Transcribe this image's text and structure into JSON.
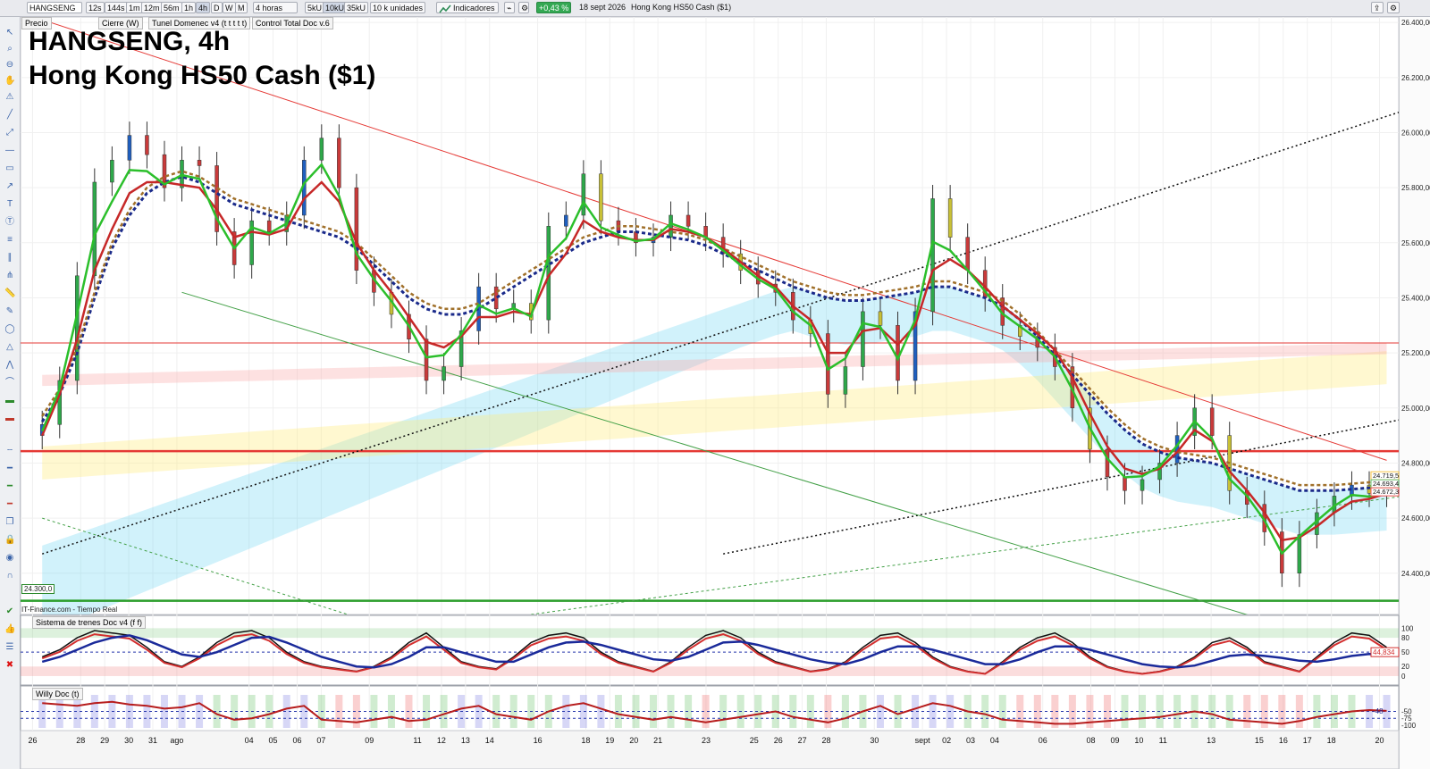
{
  "toolbar": {
    "symbol": "HANGSENG",
    "timeframes": [
      "12s",
      "144s",
      "1m",
      "12m",
      "56m",
      "1h",
      "4h",
      "D",
      "W",
      "M"
    ],
    "period": "4 horas",
    "units": [
      "5kU",
      "10kU",
      "35kU"
    ],
    "quantity": "10 k unidades",
    "indicators_label": "Indicadores",
    "change": "+0,43 %",
    "date": "18 sept 2026",
    "instrument": "Hong Kong HS50 Cash ($1)"
  },
  "legend_items": [
    "Precio",
    "Cierre (W)",
    "Tunel Domenec v4 (t t t t t)",
    "Control Total Doc v.6"
  ],
  "chart_data": [
    {
      "type": "line",
      "title": "HANGSENG, 4h",
      "subtitle": "Hong Kong HS50 Cash ($1)",
      "ylim": [
        24250,
        26420
      ],
      "y_ticks": [
        26400,
        26200,
        26000,
        25800,
        25600,
        25400,
        25200,
        25000,
        24800,
        24600,
        24400
      ],
      "x_labels": [
        "26",
        "28",
        "29",
        "30",
        "31",
        "ago",
        "04",
        "05",
        "06",
        "07",
        "09",
        "11",
        "12",
        "13",
        "14",
        "16",
        "18",
        "19",
        "20",
        "21",
        "23",
        "25",
        "26",
        "27",
        "28",
        "30",
        "sept",
        "02",
        "03",
        "04",
        "06",
        "08",
        "09",
        "10",
        "11",
        "13",
        "15",
        "16",
        "17",
        "18",
        "20"
      ],
      "x": [
        0,
        2,
        3,
        4,
        5,
        6,
        9,
        10,
        11,
        12,
        14,
        16,
        17,
        18,
        19,
        21,
        23,
        24,
        25,
        26,
        28,
        30,
        31,
        32,
        33,
        35,
        37,
        38,
        39,
        40,
        42,
        44,
        45,
        46,
        47,
        49,
        51,
        52,
        53,
        54,
        56
      ],
      "x_range": [
        -0.5,
        56.8
      ],
      "close": [
        24940,
        25100,
        25480,
        25820,
        25900,
        25990,
        25920,
        25800,
        25900,
        25880,
        25640,
        25520,
        25680,
        25640,
        25700,
        25900,
        25980,
        25800,
        25500,
        25420,
        25340,
        25250,
        25100,
        25150,
        25280,
        25440,
        25360,
        25380,
        25320,
        25660,
        25700,
        25850,
        25680,
        25640,
        25600,
        25620,
        25700,
        25660,
        25620,
        25560,
        25500,
        25450,
        25420,
        25320,
        25270,
        25050,
        25150,
        25350,
        25300,
        25100,
        25350,
        25760,
        25620,
        25500,
        25400,
        25300,
        25260,
        25220,
        25150,
        25000,
        24850,
        24750,
        24700,
        24740,
        24800,
        24900,
        25000,
        24900,
        24700,
        24650,
        24550,
        24400,
        24540,
        24620,
        24680,
        24720,
        24690,
        24710
      ],
      "moving_average": [
        24900,
        25050,
        25250,
        25500,
        25650,
        25780,
        25820,
        25820,
        25810,
        25800,
        25720,
        25620,
        25640,
        25630,
        25650,
        25760,
        25820,
        25750,
        25600,
        25500,
        25420,
        25330,
        25240,
        25220,
        25260,
        25330,
        25330,
        25350,
        25340,
        25480,
        25560,
        25680,
        25640,
        25620,
        25610,
        25610,
        25650,
        25640,
        25620,
        25580,
        25530,
        25480,
        25440,
        25370,
        25320,
        25200,
        25200,
        25280,
        25290,
        25230,
        25300,
        25500,
        25540,
        25500,
        25440,
        25370,
        25320,
        25270,
        25210,
        25110,
        24980,
        24860,
        24780,
        24760,
        24780,
        24840,
        24920,
        24880,
        24770,
        24700,
        24620,
        24520,
        24530,
        24570,
        24620,
        24660,
        24670,
        24690
      ],
      "slow_average": [
        24950,
        25050,
        25200,
        25400,
        25580,
        25700,
        25780,
        25820,
        25840,
        25820,
        25780,
        25740,
        25720,
        25700,
        25680,
        25660,
        25640,
        25620,
        25580,
        25520,
        25460,
        25400,
        25360,
        25340,
        25340,
        25360,
        25400,
        25440,
        25480,
        25520,
        25560,
        25600,
        25620,
        25640,
        25640,
        25630,
        25620,
        25610,
        25590,
        25560,
        25530,
        25500,
        25470,
        25440,
        25420,
        25400,
        25390,
        25390,
        25400,
        25410,
        25420,
        25440,
        25440,
        25420,
        25400,
        25370,
        25320,
        25260,
        25190,
        25120,
        25050,
        24980,
        24920,
        24870,
        24840,
        24820,
        24810,
        24800,
        24780,
        24760,
        24740,
        24720,
        24700,
        24700,
        24700,
        24705,
        24710,
        24715
      ],
      "support_resistance": [
        24843,
        25236,
        24300
      ],
      "price_tags": [
        "24.719,5",
        "24.693,4",
        "24.672,3"
      ],
      "low_label": "24.300,0",
      "source": "IT-Finance.com - Tiempo Real"
    },
    {
      "type": "line",
      "title": "Sistema de trenes Doc v4 (f f)",
      "ylim": [
        -15,
        110
      ],
      "y_ticks": [
        100,
        80,
        50,
        20,
        0
      ],
      "readout": "44,834",
      "oscillator": [
        40,
        55,
        80,
        95,
        90,
        85,
        60,
        30,
        20,
        40,
        70,
        90,
        95,
        80,
        50,
        30,
        20,
        15,
        10,
        20,
        40,
        70,
        90,
        60,
        30,
        20,
        15,
        40,
        70,
        85,
        90,
        80,
        50,
        30,
        20,
        10,
        30,
        60,
        85,
        95,
        80,
        50,
        30,
        20,
        10,
        15,
        30,
        60,
        85,
        90,
        70,
        40,
        20,
        10,
        5,
        30,
        60,
        80,
        90,
        70,
        40,
        20,
        10,
        5,
        10,
        20,
        40,
        70,
        80,
        60,
        30,
        20,
        10,
        40,
        70,
        90,
        85,
        60
      ],
      "signal": [
        30,
        40,
        55,
        70,
        80,
        85,
        75,
        60,
        45,
        40,
        50,
        65,
        80,
        82,
        70,
        55,
        40,
        30,
        20,
        18,
        25,
        40,
        60,
        60,
        50,
        40,
        30,
        30,
        45,
        60,
        70,
        72,
        65,
        55,
        45,
        35,
        32,
        40,
        55,
        70,
        72,
        65,
        55,
        45,
        35,
        28,
        25,
        35,
        50,
        62,
        62,
        55,
        45,
        35,
        25,
        25,
        35,
        50,
        62,
        62,
        55,
        45,
        35,
        25,
        20,
        18,
        22,
        32,
        42,
        45,
        42,
        38,
        32,
        30,
        35,
        42,
        46,
        45
      ]
    },
    {
      "type": "bar",
      "title": "Willy Doc (t)",
      "ylim": [
        -110,
        10
      ],
      "y_ticks": [
        -50,
        -75,
        -100
      ],
      "readout": "-48",
      "values": [
        -20,
        -25,
        -30,
        -20,
        -15,
        -25,
        -30,
        -40,
        -35,
        -20,
        -60,
        -80,
        -75,
        -60,
        -40,
        -30,
        -80,
        -85,
        -90,
        -80,
        -70,
        -85,
        -80,
        -60,
        -40,
        -30,
        -60,
        -70,
        -80,
        -50,
        -30,
        -20,
        -40,
        -60,
        -70,
        -80,
        -70,
        -80,
        -90,
        -80,
        -70,
        -60,
        -50,
        -70,
        -80,
        -90,
        -75,
        -50,
        -30,
        -60,
        -40,
        -20,
        -30,
        -50,
        -60,
        -80,
        -85,
        -90,
        -95,
        -95,
        -90,
        -85,
        -80,
        -75,
        -70,
        -60,
        -50,
        -60,
        -80,
        -85,
        -90,
        -95,
        -85,
        -70,
        -60,
        -50,
        -45,
        -48
      ]
    }
  ]
}
